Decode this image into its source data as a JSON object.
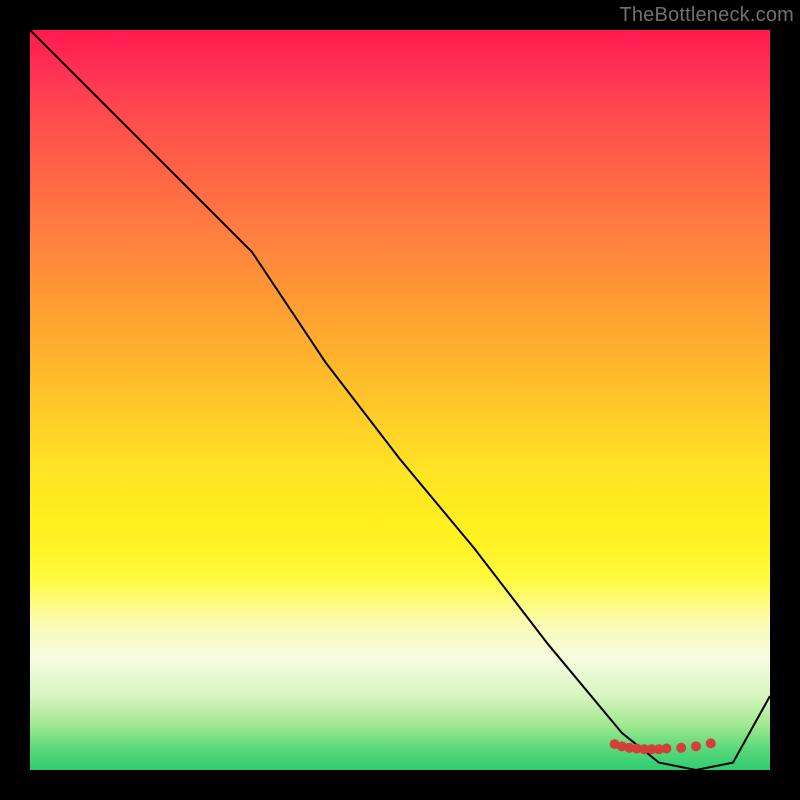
{
  "watermark": "TheBottleneck.com",
  "chart_data": {
    "type": "line",
    "title": "",
    "xlabel": "",
    "ylabel": "",
    "xlim": [
      0,
      100
    ],
    "ylim": [
      0,
      100
    ],
    "grid": false,
    "series": [
      {
        "name": "curve",
        "x": [
          0,
          10,
          20,
          30,
          40,
          50,
          60,
          70,
          80,
          85,
          90,
          95,
          100
        ],
        "y": [
          100,
          90,
          80,
          70,
          55,
          42,
          30,
          17,
          5,
          1,
          0,
          1,
          10
        ],
        "color": "#000000",
        "stroke_width": 2
      }
    ],
    "markers": {
      "name": "minimum-band",
      "color": "#d43f3a",
      "points": [
        {
          "x": 79,
          "y": 3.5
        },
        {
          "x": 80,
          "y": 3.2
        },
        {
          "x": 81,
          "y": 3.0
        },
        {
          "x": 82,
          "y": 2.9
        },
        {
          "x": 83,
          "y": 2.8
        },
        {
          "x": 84,
          "y": 2.8
        },
        {
          "x": 85,
          "y": 2.8
        },
        {
          "x": 86,
          "y": 2.9
        },
        {
          "x": 88,
          "y": 3.0
        },
        {
          "x": 90,
          "y": 3.2
        },
        {
          "x": 92,
          "y": 3.6
        }
      ],
      "radius": 5
    }
  }
}
